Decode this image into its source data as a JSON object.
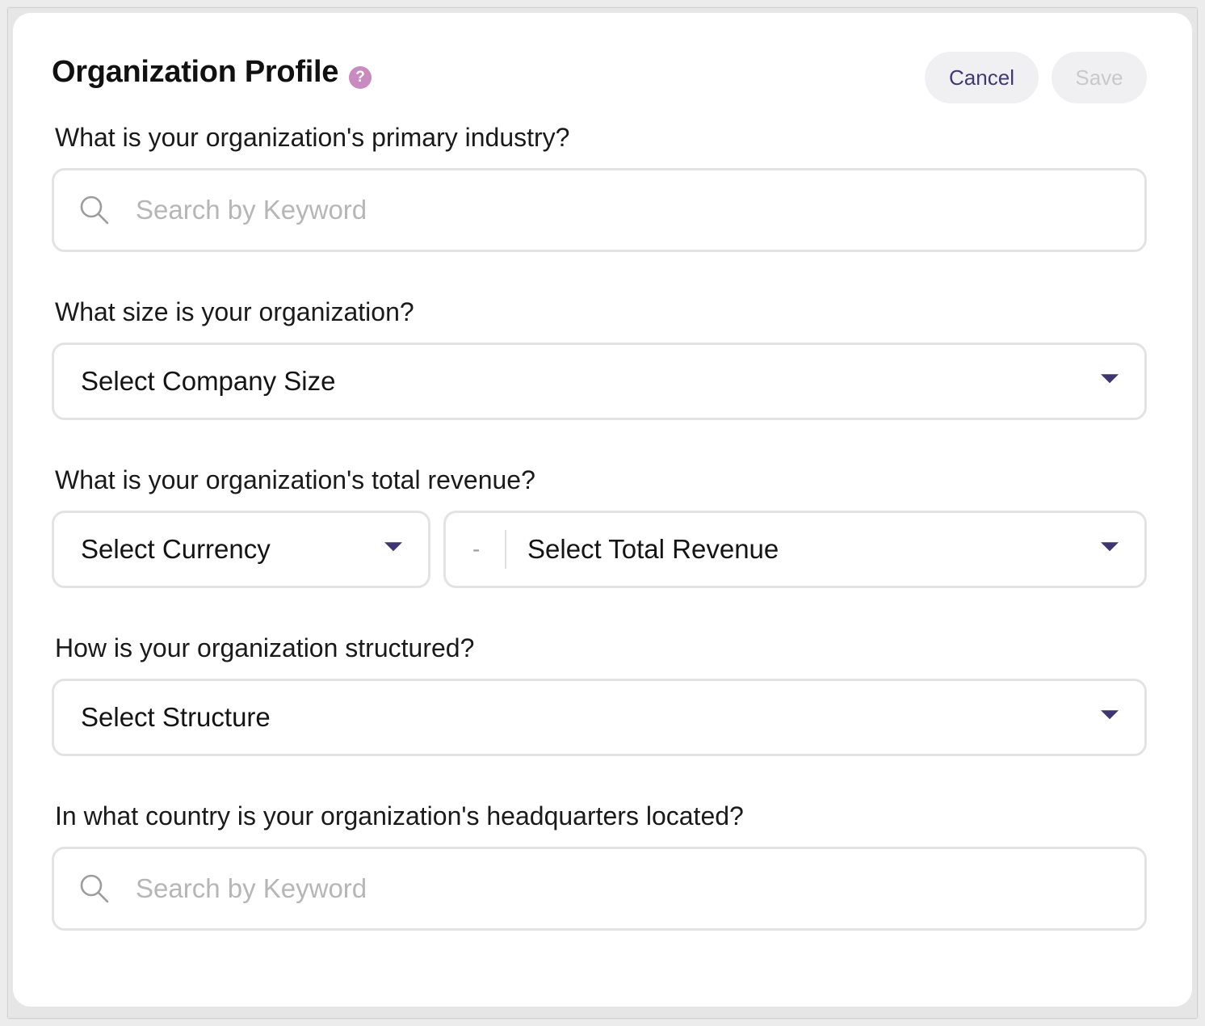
{
  "header": {
    "title": "Organization Profile",
    "help_icon_glyph": "?",
    "cancel_label": "Cancel",
    "save_label": "Save"
  },
  "industry": {
    "question": "What is your organization's primary industry?",
    "placeholder": "Search by Keyword",
    "icon": "search-icon"
  },
  "size": {
    "question": "What size is your organization?",
    "selected": "Select Company Size",
    "icon": "caret-down-icon"
  },
  "revenue": {
    "question": "What is your organization's total revenue?",
    "currency_selected": "Select Currency",
    "amount_prefix": "-",
    "amount_selected": "Select Total Revenue"
  },
  "structure": {
    "question": "How is your organization structured?",
    "selected": "Select Structure"
  },
  "country": {
    "question": "In what country is your organization's headquarters located?",
    "placeholder": "Search by Keyword",
    "icon": "search-icon"
  },
  "colors": {
    "accent": "#3f3573",
    "help_icon": "#c98bbf",
    "border": "#e3e3e3",
    "placeholder": "#b6b6b6",
    "button_bg": "#f0f0f2",
    "save_disabled_text": "#c9c9cc"
  }
}
